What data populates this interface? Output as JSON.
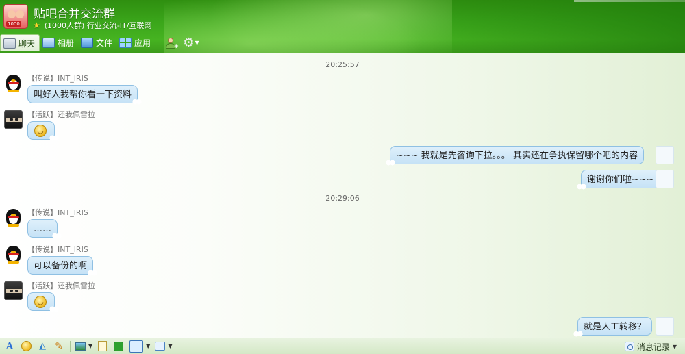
{
  "window": {
    "group_name": "贴吧合并交流群",
    "group_info": "(1000人群) 行业交流-IT/互联网",
    "avatar_tag": "1000"
  },
  "tabs": [
    {
      "label": "聊天",
      "icon": "chat-icon",
      "active": true
    },
    {
      "label": "相册",
      "icon": "album-icon",
      "active": false
    },
    {
      "label": "文件",
      "icon": "folder-icon",
      "active": false
    },
    {
      "label": "应用",
      "icon": "apps-icon",
      "active": false
    }
  ],
  "chat": {
    "timestamps": [
      "20:25:57",
      "20:29:06"
    ],
    "messages": [
      {
        "side": "left",
        "sender": "【传说】INT_IRIS",
        "text": "叫好人我帮你看一下资料",
        "avatar": "penguin-avatar"
      },
      {
        "side": "left",
        "sender": "【活跃】还我佩雷拉",
        "emoji": "smiley-emoji",
        "avatar": "ninja-avatar"
      },
      {
        "side": "right",
        "text": "~~~  我就是先咨询下拉。。。  其实还在争执保留哪个吧的内容"
      },
      {
        "side": "right",
        "text": "谢谢你们啦~~~"
      },
      {
        "side": "left",
        "sender": "【传说】INT_IRIS",
        "text": "……",
        "avatar": "penguin-avatar"
      },
      {
        "side": "left",
        "sender": "【传说】INT_IRIS",
        "text": "可以备份的啊",
        "avatar": "penguin-avatar"
      },
      {
        "side": "left",
        "sender": "【活跃】还我佩雷拉",
        "emoji": "smiley-emoji",
        "avatar": "ninja-avatar"
      },
      {
        "side": "right",
        "text": "就是人工转移？"
      }
    ]
  },
  "toolbar": {
    "history_label": "消息记录",
    "icons": [
      "font-icon",
      "face-icon",
      "shake-icon",
      "pen-icon",
      "image-icon",
      "document-icon",
      "app-icon",
      "screenshot-icon",
      "message-icon"
    ]
  }
}
